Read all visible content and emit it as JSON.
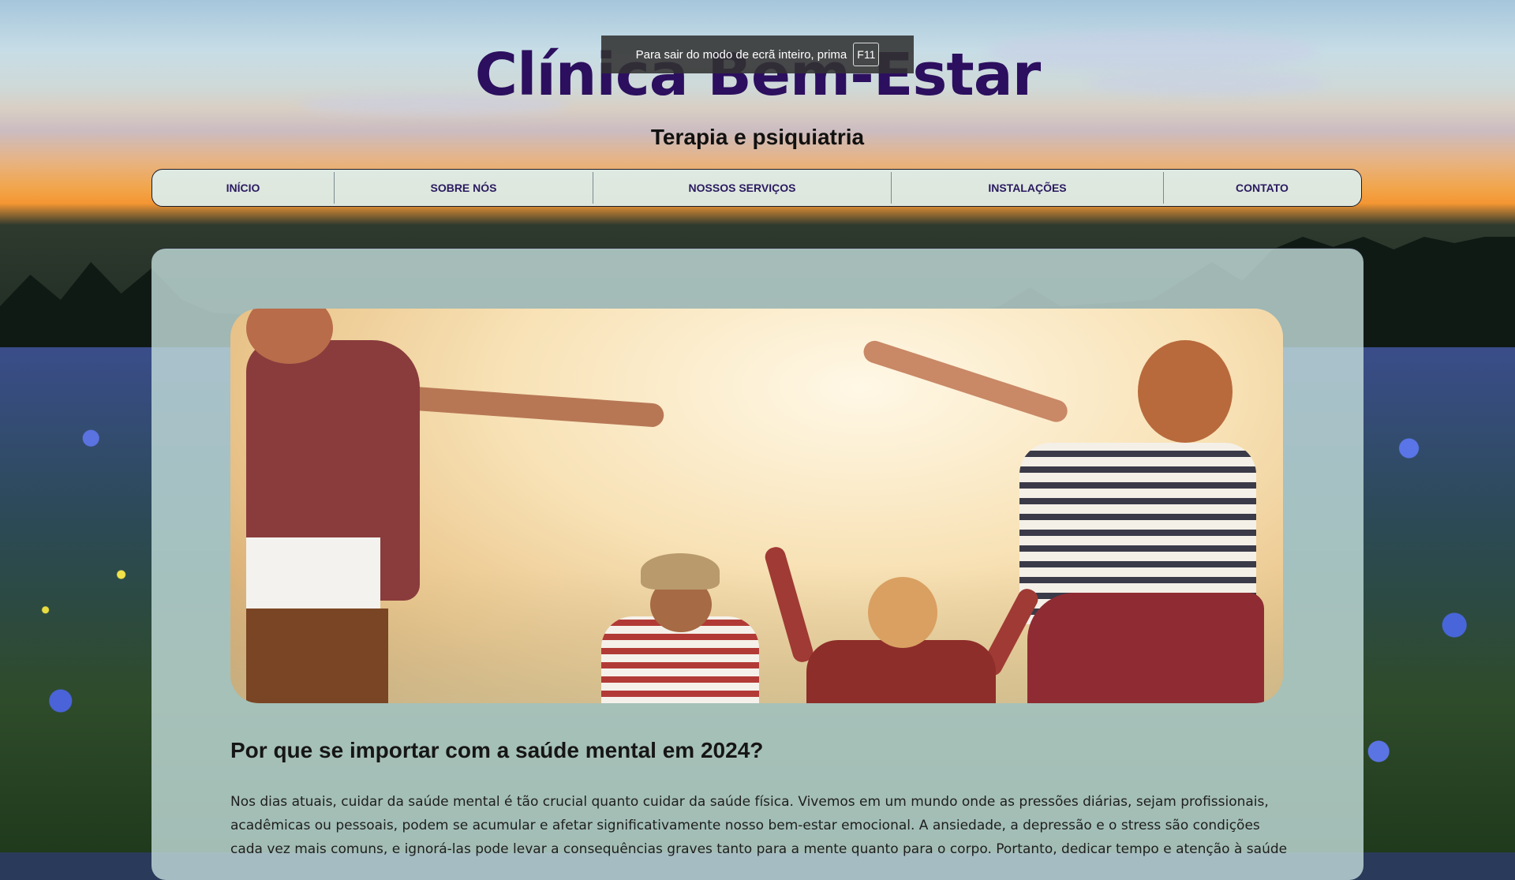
{
  "fullscreen_notice": {
    "text": "Para sair do modo de ecrã inteiro, prima",
    "key": "F11"
  },
  "header": {
    "title": "Clínica Bem-Estar",
    "subtitle": "Terapia e psiquiatria"
  },
  "nav": {
    "items": [
      {
        "label": "INÍCIO"
      },
      {
        "label": "SOBRE NÓS"
      },
      {
        "label": "NOSSOS SERVIÇOS"
      },
      {
        "label": "INSTALAÇÕES"
      },
      {
        "label": "CONTATO"
      }
    ]
  },
  "main": {
    "heading": "Por que se importar com a saúde mental em 2024?",
    "body": "Nos dias atuais, cuidar da saúde mental é tão crucial quanto cuidar da saúde física. Vivemos em um mundo onde as pressões diárias, sejam profissionais, acadêmicas ou pessoais, podem se acumular e afetar significativamente nosso bem-estar emocional. A ansiedade, a depressão e o stress são condições cada vez mais comuns, e ignorá-las pode levar a consequências graves tanto para a mente quanto para o corpo. Portanto, dedicar tempo e atenção à saúde"
  },
  "colors": {
    "title": "#2c0f5e",
    "nav_text": "#2a1a60",
    "card_bg": "#c4dedc"
  }
}
